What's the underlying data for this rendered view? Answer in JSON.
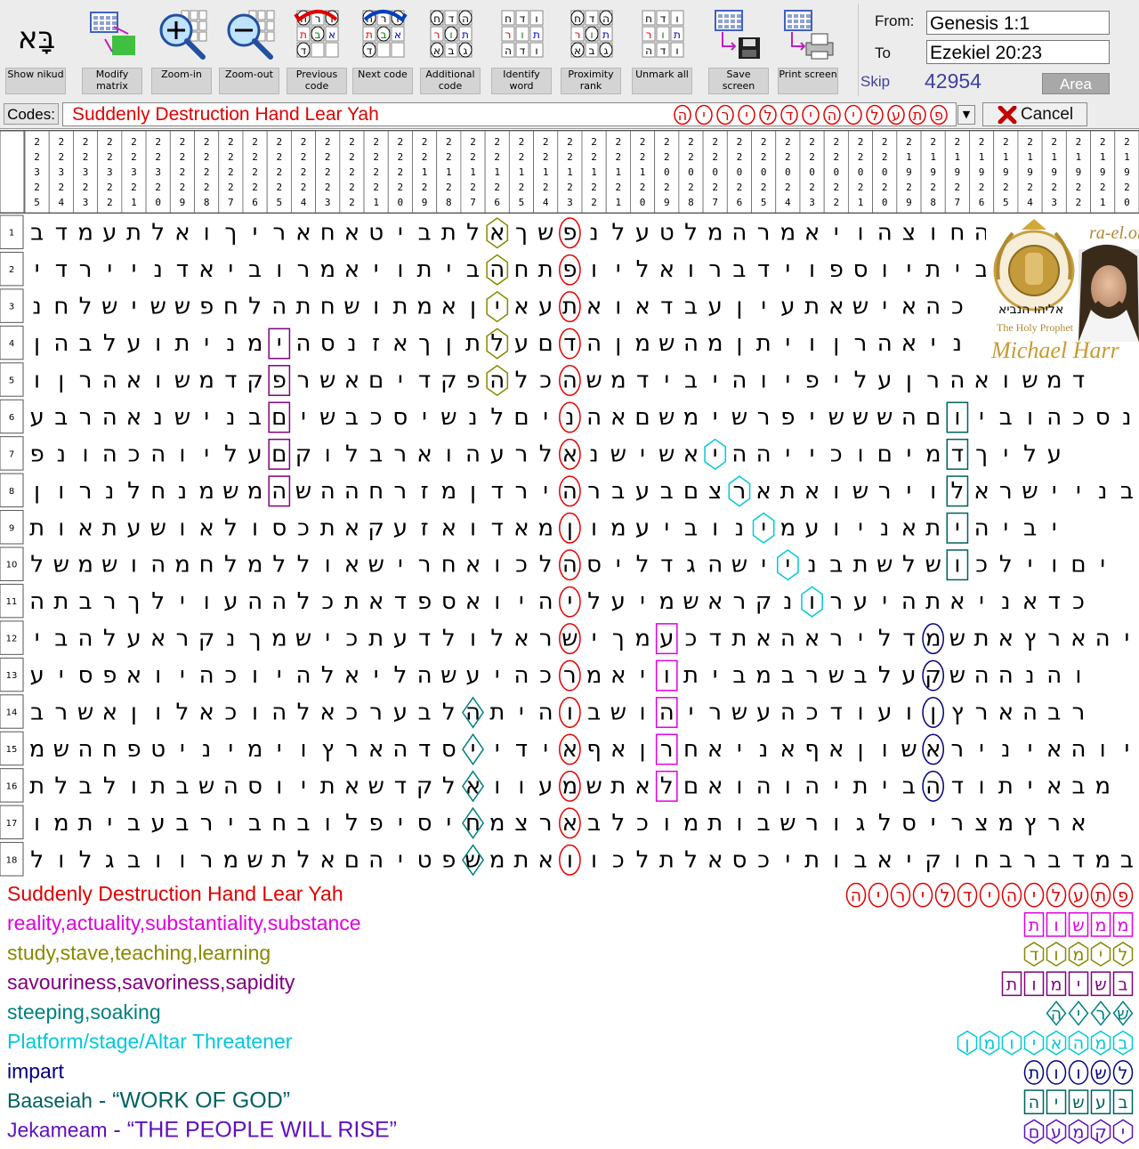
{
  "toolbar": {
    "buttons": [
      {
        "id": "show-nikud",
        "label": "Show nikud",
        "icon": "show-nikud-icon",
        "glyph": "בָּא"
      },
      {
        "id": "modify-matrix",
        "label": "Modify matrix",
        "icon": "modify-matrix-icon"
      },
      {
        "id": "zoom-in",
        "label": "Zoom-in",
        "icon": "zoom-in-icon"
      },
      {
        "id": "zoom-out",
        "label": "Zoom-out",
        "icon": "zoom-out-icon"
      },
      {
        "id": "previous-code",
        "label": "Previous code",
        "icon": "previous-code-icon",
        "glyphs": [
          "ה",
          "ר",
          "ו",
          "ת",
          "ב",
          "א",
          "ד"
        ]
      },
      {
        "id": "next-code",
        "label": "Next code",
        "icon": "next-code-icon",
        "glyphs": [
          "ה",
          "ר",
          "ו",
          "ת",
          "ב",
          "א",
          "ד"
        ]
      },
      {
        "id": "additional-code",
        "label": "Additional code",
        "icon": "additional-code-icon",
        "glyphs": [
          "ח",
          "ד",
          "ה",
          "ר",
          "ו",
          "ת",
          "א",
          "ב",
          "ג"
        ]
      },
      {
        "id": "identify-word",
        "label": "Identify word",
        "icon": "identify-word-icon",
        "glyphs": [
          "ח",
          "ד",
          "ו",
          "ר",
          "ו",
          "ת",
          "ה",
          "ד",
          "ו"
        ]
      },
      {
        "id": "proximity-rank",
        "label": "Proximity rank",
        "icon": "proximity-rank-icon",
        "glyphs": [
          "ח",
          "ד",
          "ה",
          "ר",
          "ו",
          "ת",
          "א",
          "ב",
          "ג"
        ]
      },
      {
        "id": "unmark-all",
        "label": "Unmark all",
        "icon": "unmark-all-icon",
        "glyphs": [
          "ח",
          "ד",
          "ו",
          "ר",
          "ו",
          "ת",
          "ה",
          "ד",
          "ו"
        ]
      },
      {
        "id": "save-screen",
        "label": "Save screen",
        "icon": "save-screen-icon"
      },
      {
        "id": "print-screen",
        "label": "Print screen",
        "icon": "print-screen-icon"
      }
    ],
    "range": {
      "from_label": "From:",
      "from_value": "Genesis 1:1",
      "to_label": "To",
      "to_value": "Ezekiel 20:23",
      "skip_label": "Skip",
      "skip_value": "42954",
      "area_label": "Area"
    }
  },
  "codes": {
    "label": "Codes:",
    "value": "Suddenly Destruction Hand Lear Yah",
    "hebrew": "פתעליהידליריה",
    "cancel_label": "Cancel"
  },
  "columns": [
    "235",
    "234",
    "233",
    "232",
    "231",
    "230",
    "229",
    "228",
    "227",
    "226",
    "225",
    "224",
    "223",
    "222",
    "221",
    "220",
    "219",
    "218",
    "217",
    "216",
    "215",
    "214",
    "213",
    "212",
    "211",
    "210",
    "209",
    "208",
    "207",
    "206",
    "205",
    "204",
    "203",
    "202",
    "201",
    "200",
    "199",
    "198",
    "197",
    "196",
    "195",
    "194",
    "193",
    "192",
    "191",
    "190"
  ],
  "rows": [
    {
      "num": "1",
      "text": "בדמעתלאוךיראחאטיבתלאךשפנלעטלמהרמאיוהצוחהס"
    },
    {
      "num": "2",
      "text": "ידריינדאיבורמאיותיבהחתפוילאורבדיופסויתיב"
    },
    {
      "num": "3",
      "text": "נחלשיששפחלהתחשותמאןיאעתאואדבעןיעתאשיאהכ"
    },
    {
      "num": "4",
      "text": "ןהבלעותינמיהסנזאךןתלעםדהןמשהמןתיוןרהאינ"
    },
    {
      "num": "5",
      "text": "וןרהאושמדקפרשאםידקפהלכהשמדיביהויפילעןרהאושמד"
    },
    {
      "num": "6",
      "text": "עברהאנשינבםישבכסישנלםינהאםשמישרפישששהםויבוהכסנוה"
    },
    {
      "num": "7",
      "text": "פנוהכהוילעםקולבראוהערלאנשישאיההייכוםימדךילע"
    },
    {
      "num": "8",
      "text": "ןורנלחנמשמהשההחרזמןדריהרבעבםצראתאושריולארשיינב"
    },
    {
      "num": "9",
      "text": "תואתעשואלוסכתאקעזאודאמןומעיבונימעוינאתיהיבי"
    },
    {
      "num": "10",
      "text": "לשמשוהמחלמללואשירחאוכלהסילדגהשיינבתשלשוכליוםי"
    },
    {
      "num": "11",
      "text": "התברךליועההלכתאדפסאויהילעימשארקנורעיהתאינאדכ"
    },
    {
      "num": "12",
      "text": "יבהלעארקנךמשיכתעדלולארשיךמעכדתאהארילדמשתאץראהי"
    },
    {
      "num": "13",
      "text": "עיספאויהכויהלאילהשעיהכרמאיותיבמברשבלעקשההנהו"
    },
    {
      "num": "14",
      "text": "ברשאןולאכוהלאכרעבלהתיהובשוהירשעהכדועוןץראהבר"
    },
    {
      "num": "15",
      "text": "משהחפטינימיוץראהדסיידיאףאןרחאינאףאןושאריניאהוי"
    },
    {
      "num": "16",
      "text": "תלבלותבשהסויתאשדקלאוועמשתאלםאוהוהיתיבהדותיאבמ"
    },
    {
      "num": "17",
      "text": "ומתיבעבריבחבולפיסיחמצראבלכומתובשרוגלסירצמץרא"
    },
    {
      "num": "18",
      "text": "לולגבוורמשתלאםהיטפשמתאווכלתלאסכיתובאיקוחברבדמב"
    }
  ],
  "legend": [
    {
      "text": "Suddenly Destruction Hand Lear Yah",
      "color": "#e00000",
      "hebrew": "פתעליהידליריה",
      "shape": "oval"
    },
    {
      "text": "reality,actuality,substantiality,substance",
      "color": "#e000e0",
      "hebrew": "ממשות",
      "shape": "rect"
    },
    {
      "text": "study,stave,teaching,learning",
      "color": "#888800",
      "hebrew": "לימוד",
      "shape": "hex"
    },
    {
      "text": "savouriness,savoriness,sapidity",
      "color": "#800080",
      "hebrew": "בשימות",
      "shape": "rect"
    },
    {
      "text": "steeping,soaking",
      "color": "#008080",
      "hebrew": "שריה",
      "shape": "diamond"
    },
    {
      "text": "Platform/stage/Altar Threatener",
      "color": "#00c8d8",
      "hebrew": "במהאיומן",
      "shape": "hex"
    },
    {
      "text": "impart",
      "color": "#000080",
      "hebrew": "לשוות",
      "shape": "oval"
    },
    {
      "text": "Baaseiah",
      "color": "#006060",
      "suffix": " - “WORK OF GOD”",
      "hebrew": "בעשיה",
      "shape": "rect"
    },
    {
      "text": "Jekameam",
      "color": "#6010c0",
      "suffix": " - “THE PEOPLE WILL RISE”",
      "hebrew": "יקמעם",
      "shape": "hex"
    }
  ],
  "watermark": {
    "site": "ra-el.org",
    "hebrew": "אליהו הנביא",
    "subtitle": "The Holy Prophet",
    "name": "Michael Harr"
  },
  "colors": {
    "grid_text": "#000000",
    "toolbar_bg": "#ececec",
    "code_red": "#e00000"
  }
}
